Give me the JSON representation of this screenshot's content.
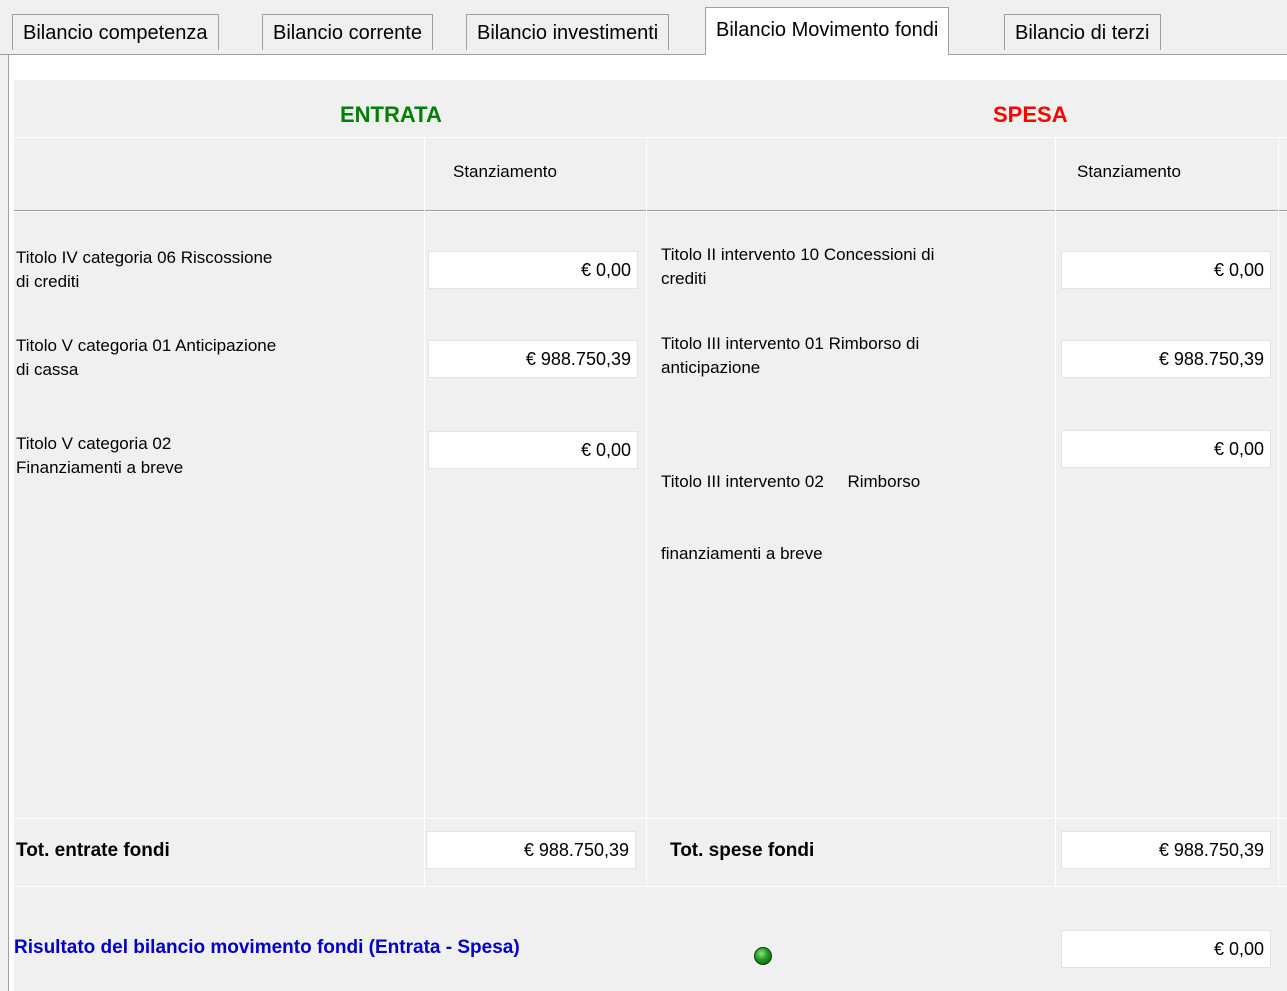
{
  "tabs": [
    {
      "label": "Bilancio competenza"
    },
    {
      "label": "Bilancio corrente"
    },
    {
      "label": "Bilancio investimenti"
    },
    {
      "label": "Bilancio Movimento fondi"
    },
    {
      "label": "Bilancio di terzi"
    }
  ],
  "active_tab": "Bilancio Movimento fondi",
  "entrata": {
    "header": "ENTRATA",
    "color": "#008000",
    "column_header": "Stanziamento",
    "rows": [
      {
        "line1": "Titolo IV categoria 06 Riscossione",
        "line2": "di crediti",
        "value": "€ 0,00"
      },
      {
        "line1": "Titolo V categoria 01 Anticipazione",
        "line2": "di cassa",
        "value": "€ 988.750,39"
      },
      {
        "line1": "Titolo V categoria 02",
        "line2": "Finanziamenti a breve",
        "value": "€ 0,00"
      }
    ],
    "total_label": "Tot. entrate fondi",
    "total_value": "€ 988.750,39"
  },
  "spesa": {
    "header": "SPESA",
    "color": "#ff0000",
    "column_header": "Stanziamento",
    "rows": [
      {
        "line1": "Titolo II intervento 10 Concessioni di",
        "line2": "crediti",
        "value": "€ 0,00"
      },
      {
        "line1": "Titolo III intervento 01 Rimborso di",
        "line2": "anticipazione",
        "value": "€ 988.750,39"
      },
      {
        "line1": "Titolo III intervento 02     Rimborso",
        "line2": "finanziamenti a breve",
        "value": "€ 0,00"
      }
    ],
    "total_label": "Tot. spese fondi",
    "total_value": "€ 988.750,39"
  },
  "result": {
    "label": "Risultato del bilancio movimento fondi (Entrata - Spesa)",
    "status_icon": "green-led-icon",
    "value": "€ 0,00"
  }
}
